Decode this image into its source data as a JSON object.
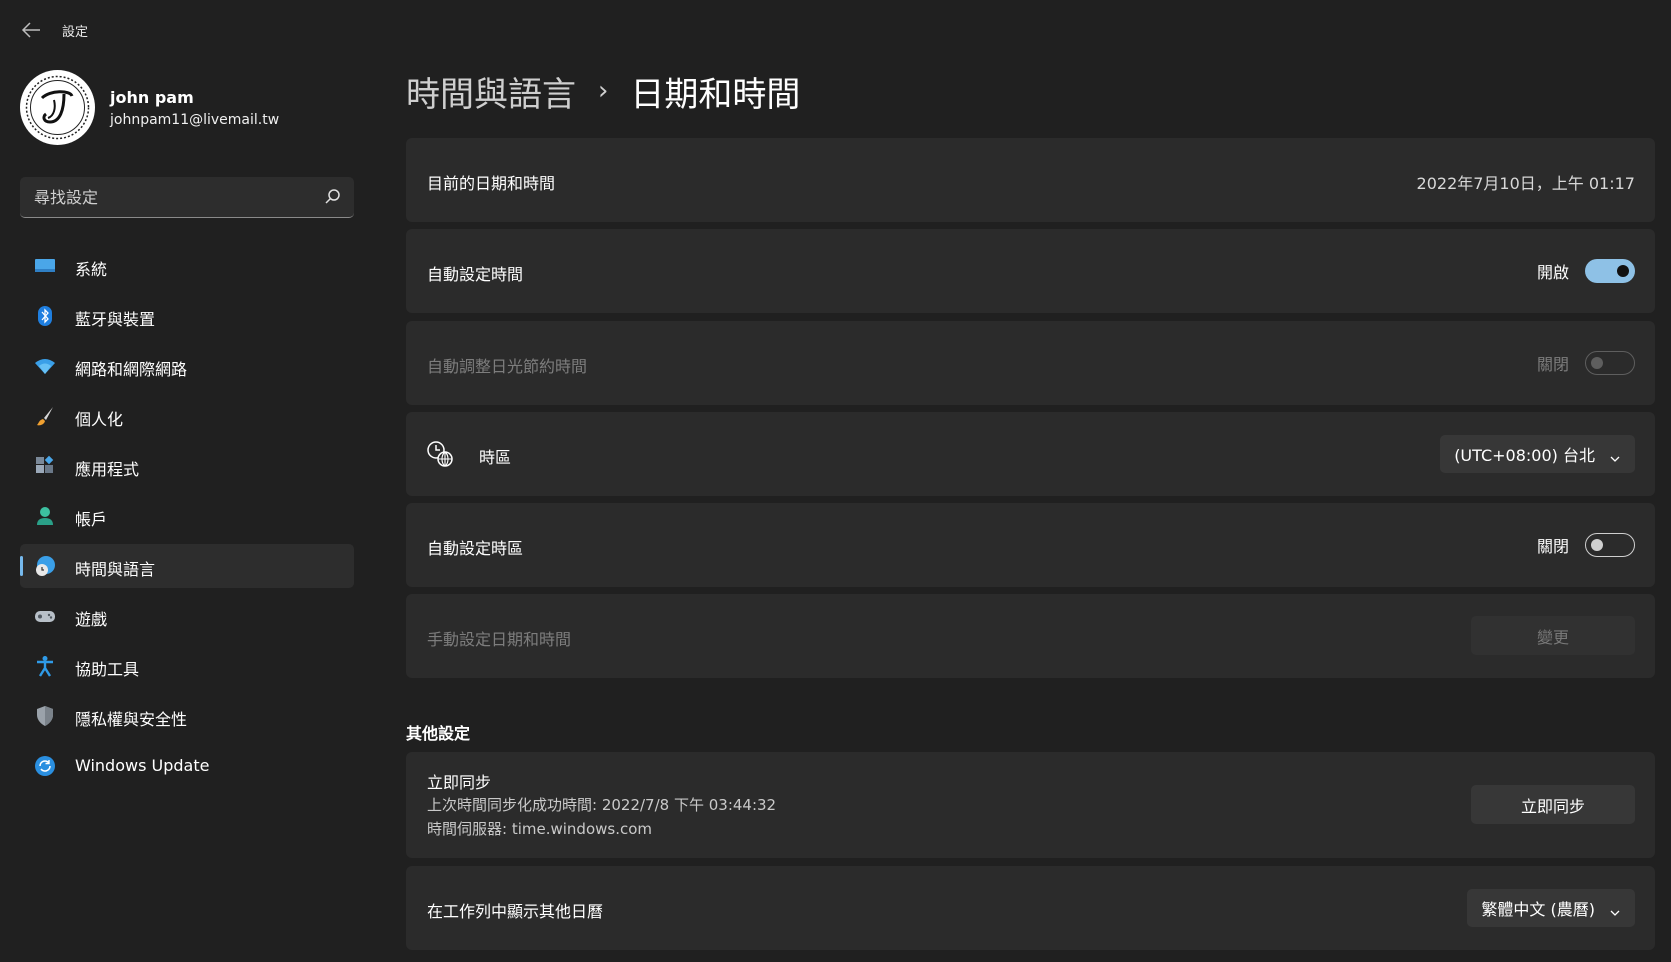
{
  "window": {
    "title": "設定"
  },
  "profile": {
    "name": "john pam",
    "email": "johnpam11@livemail.tw"
  },
  "search": {
    "placeholder": "尋找設定"
  },
  "sidebar": {
    "items": [
      {
        "label": "系統",
        "icon": "system-icon"
      },
      {
        "label": "藍牙與裝置",
        "icon": "bluetooth-icon"
      },
      {
        "label": "網路和網際網路",
        "icon": "wifi-icon"
      },
      {
        "label": "個人化",
        "icon": "brush-icon"
      },
      {
        "label": "應用程式",
        "icon": "apps-icon"
      },
      {
        "label": "帳戶",
        "icon": "account-icon"
      },
      {
        "label": "時間與語言",
        "icon": "time-language-icon",
        "active": true
      },
      {
        "label": "遊戲",
        "icon": "gaming-icon"
      },
      {
        "label": "協助工具",
        "icon": "accessibility-icon"
      },
      {
        "label": "隱私權與安全性",
        "icon": "shield-icon"
      },
      {
        "label": "Windows Update",
        "icon": "update-icon"
      }
    ]
  },
  "breadcrumb": {
    "parent": "時間與語言",
    "separator": "›",
    "current": "日期和時間"
  },
  "settings": {
    "current_datetime": {
      "label": "目前的日期和時間",
      "value": "2022年7月10日，上午 01:17"
    },
    "auto_time": {
      "label": "自動設定時間",
      "state": "開啟",
      "on": true
    },
    "auto_dst": {
      "label": "自動調整日光節約時間",
      "state": "關閉",
      "on": false,
      "disabled": true
    },
    "timezone": {
      "label": "時區",
      "value": "(UTC+08:00) 台北"
    },
    "auto_timezone": {
      "label": "自動設定時區",
      "state": "關閉",
      "on": false
    },
    "manual_datetime": {
      "label": "手動設定日期和時間",
      "button": "變更",
      "disabled": true
    }
  },
  "other": {
    "section_title": "其他設定",
    "sync": {
      "title": "立即同步",
      "last_sync": "上次時間同步化成功時間: 2022/7/8 下午 03:44:32",
      "server": "時間伺服器: time.windows.com",
      "button": "立即同步"
    },
    "calendar": {
      "label": "在工作列中顯示其他日曆",
      "value": "繁體中文 (農曆)"
    }
  },
  "colors": {
    "background": "#202020",
    "card": "#2b2b2b",
    "accent": "#8ec1e6"
  }
}
